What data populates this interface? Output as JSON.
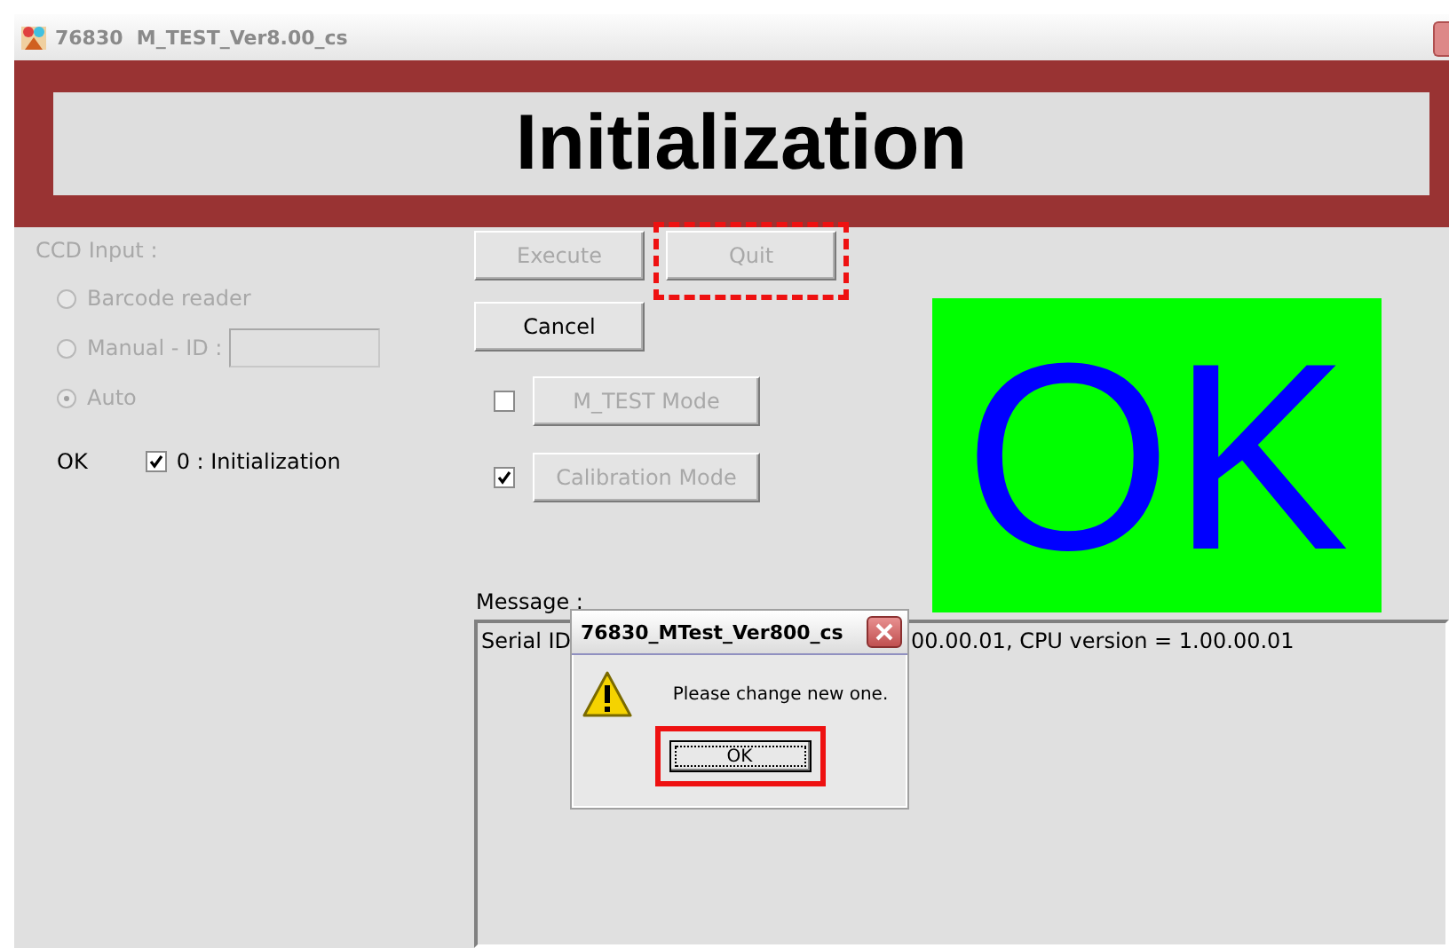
{
  "window": {
    "title": "76830  M_TEST_Ver8.00_cs"
  },
  "banner": {
    "title": "Initialization"
  },
  "ccd_input": {
    "label": "CCD Input :",
    "disabled": true,
    "options": [
      {
        "label": "Barcode reader",
        "selected": false,
        "kind": "plain"
      },
      {
        "label": "Manual - ID :",
        "selected": false,
        "kind": "field"
      },
      {
        "label": "Auto",
        "selected": true,
        "kind": "plain"
      }
    ]
  },
  "status": {
    "result": "OK",
    "steps": [
      {
        "label": "0 : Initialization",
        "checked": true
      }
    ]
  },
  "buttons": [
    {
      "label": "Execute",
      "disabled": true,
      "highlighted": false
    },
    {
      "label": "Quit",
      "disabled": true,
      "highlighted": true
    },
    {
      "label": "Cancel",
      "disabled": false,
      "highlighted": false
    }
  ],
  "modes": [
    {
      "label": "M_TEST Mode",
      "checked": false,
      "disabled": true
    },
    {
      "label": "Calibration Mode",
      "checked": true,
      "disabled": true
    }
  ],
  "result_indicator": {
    "text": "OK"
  },
  "message": {
    "label": "Message :",
    "lines": [
      {
        "left": "Serial ID",
        "right": "00.00.01, CPU version = 1.00.00.01"
      }
    ]
  },
  "dialog": {
    "title": "76830_MTest_Ver800_cs",
    "text": "Please change new one.",
    "button": {
      "label": "OK",
      "highlighted": true
    }
  }
}
